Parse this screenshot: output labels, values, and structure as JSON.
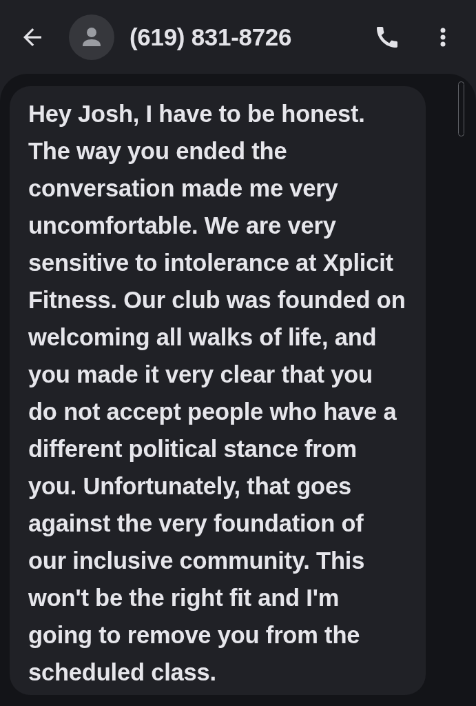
{
  "header": {
    "title": "(619) 831-8726"
  },
  "messages": [
    {
      "text": "Hey Josh, I have to be honest. The way you ended the conversation made me very uncomfortable. We are very sensitive to intolerance at Xplicit Fitness. Our club was founded on welcoming all walks of life, and you made it very clear that you do not accept people who have a different political stance from you. Unfortunately, that goes against the very foundation of our inclusive community. This won't be the right fit and I'm going to remove you from the scheduled class."
    }
  ]
}
